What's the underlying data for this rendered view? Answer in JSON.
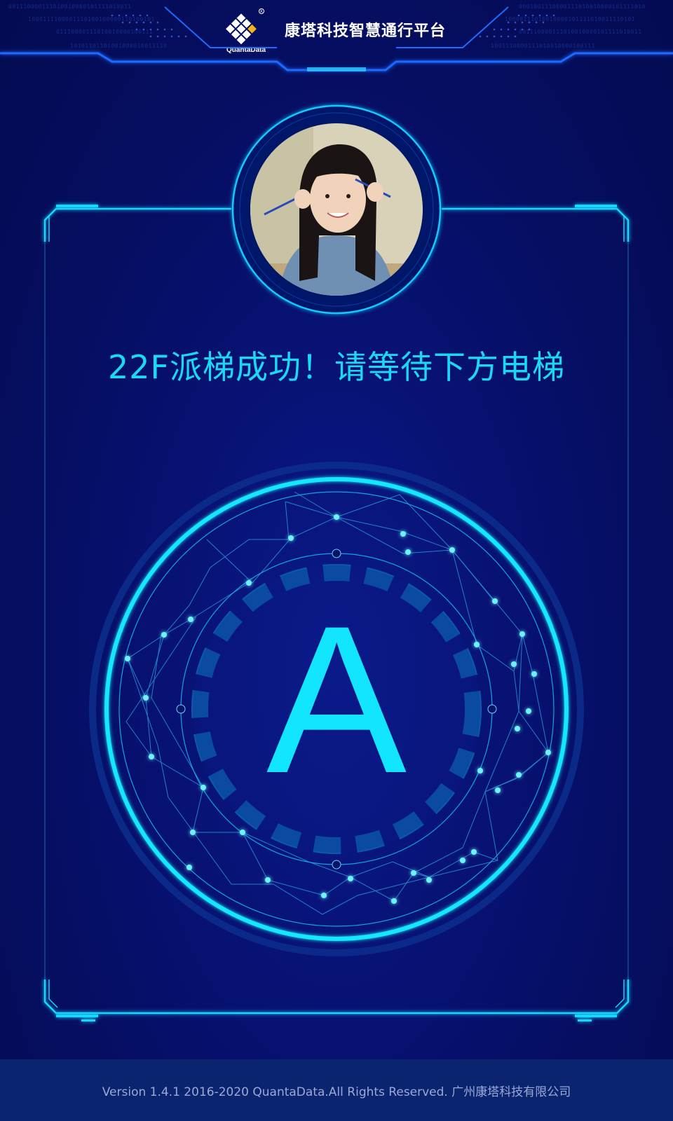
{
  "header": {
    "app_title": "康塔科技智慧通行平台",
    "logo_text": "QuantaData",
    "binary_left_1": "001110000111010010000101111010011",
    "binary_left_2": "1000111100001110100100000110100101",
    "binary_left_3": "01110000111010010000100111",
    "binary_left_4": "10101101101001000010011110",
    "binary_right_1": "0001001110000111010010000101111010",
    "binary_right_2": "10000111010010000101111010011110101",
    "binary_right_3": "001110000111010010000101111010011",
    "binary_right_4": "1001110000111010010000100111"
  },
  "main": {
    "message": "22F派梯成功！请等待下方电梯",
    "elevator_letter": "A"
  },
  "footer": {
    "copyright": "Version 1.4.1 2016-2020 QuantaData.All Rights Reserved. 广州康塔科技有限公司"
  },
  "colors": {
    "background": "#06106a",
    "accent": "#12e6ff",
    "footer_bg": "#0a2470"
  }
}
